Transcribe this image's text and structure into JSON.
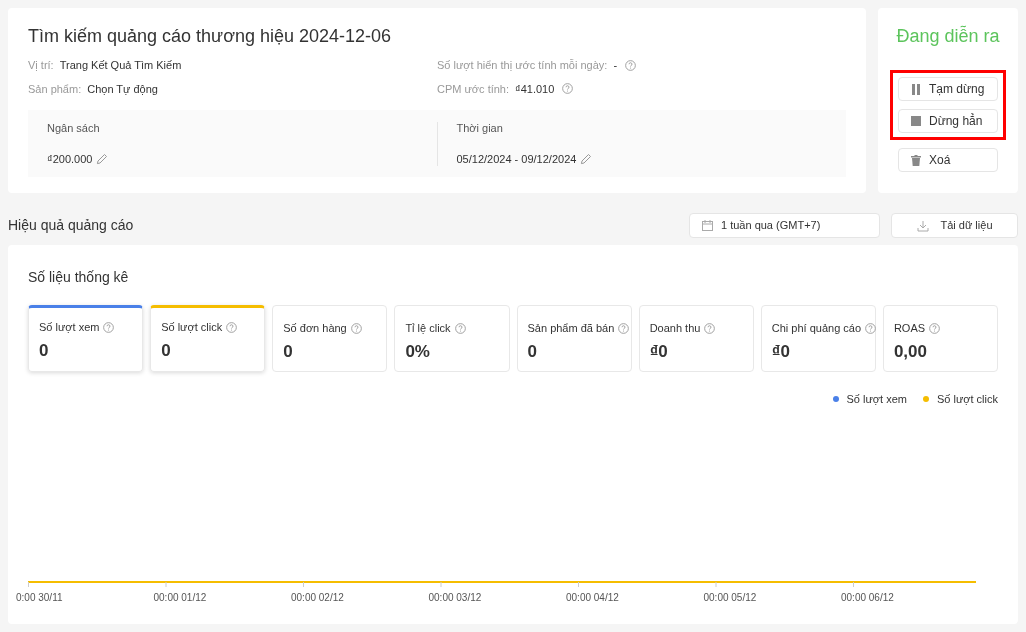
{
  "campaign": {
    "title": "Tìm kiếm quảng cáo thương hiệu 2024-12-06",
    "info": [
      {
        "label": "Vị trí:",
        "value": "Trang Kết Quả Tìm Kiếm",
        "help": false
      },
      {
        "label": "Số lượt hiển thị ước tính mỗi ngày:",
        "value": "-",
        "help": true
      },
      {
        "label": "Sản phẩm:",
        "value": "Chọn Tự động",
        "help": false
      },
      {
        "label": "CPM ước tính:",
        "value": "₫41.010",
        "help": true
      }
    ],
    "budget": {
      "label": "Ngân sách",
      "value": "₫200.000"
    },
    "period": {
      "label": "Thời gian",
      "value": "05/12/2024 - 09/12/2024"
    }
  },
  "status": {
    "text": "Đang diễn ra"
  },
  "highlighted_actions": [
    {
      "kind": "pause",
      "label": "Tạm dừng"
    },
    {
      "kind": "stop",
      "label": "Dừng hẳn"
    }
  ],
  "actions": [
    {
      "kind": "delete",
      "label": "Xoá"
    }
  ],
  "performance": {
    "title": "Hiệu quả quảng cáo",
    "date_range": "1 tuần qua (GMT+7)",
    "download": "Tải dữ liệu"
  },
  "stats": {
    "title": "Số liệu thống kê",
    "metrics": [
      {
        "label": "Số lượt xem",
        "value": "0",
        "selected": true,
        "color": "#4a80e8"
      },
      {
        "label": "Số lượt click",
        "value": "0",
        "selected": true,
        "color": "#f5bd00"
      },
      {
        "label": "Số đơn hàng",
        "value": "0",
        "selected": false
      },
      {
        "label": "Tỉ lệ click",
        "value": "0%",
        "selected": false
      },
      {
        "label": "Sản phẩm đã bán",
        "value": "0",
        "selected": false
      },
      {
        "label": "Doanh thu",
        "value": "₫0",
        "selected": false
      },
      {
        "label": "Chi phí quảng cáo",
        "value": "₫0",
        "selected": false
      },
      {
        "label": "ROAS",
        "value": "0,00",
        "selected": false
      }
    ],
    "legend": [
      {
        "label": "Số lượt xem",
        "color": "#4a80e8"
      },
      {
        "label": "Số lượt click",
        "color": "#f5bd00"
      }
    ],
    "x_axis_labels": [
      "0:00 30/11",
      "00:00 01/12",
      "00:00 02/12",
      "00:00 03/12",
      "00:00 04/12",
      "00:00 05/12",
      "00:00 06/12"
    ]
  }
}
